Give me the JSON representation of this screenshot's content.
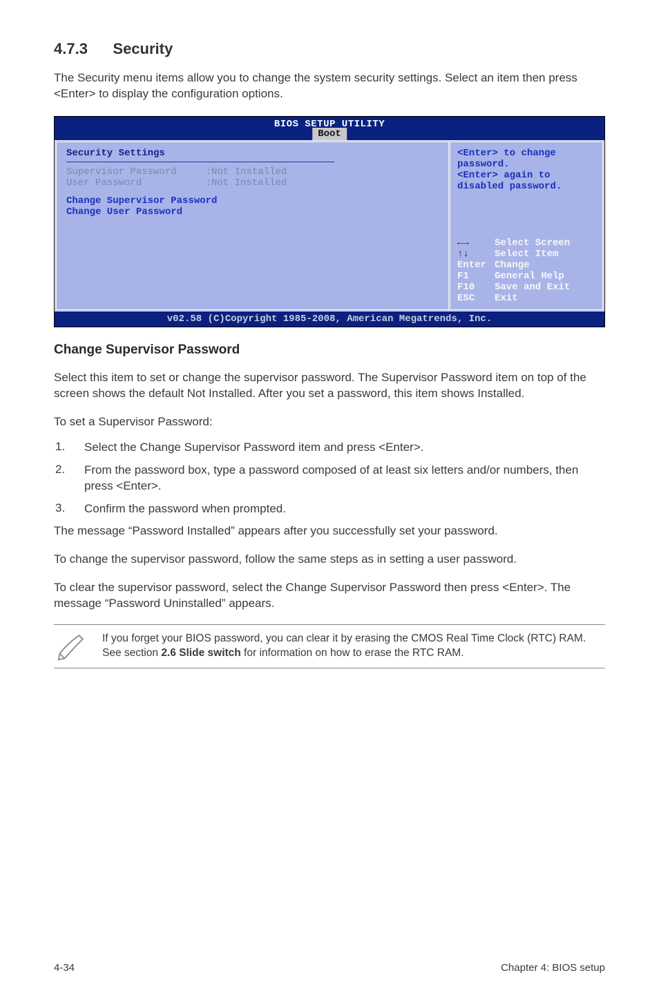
{
  "section": {
    "number": "4.7.3",
    "title": "Security"
  },
  "intro": "The Security menu items allow you to change the system security settings. Select an item then press <Enter> to display the configuration options.",
  "bios": {
    "headerTitle": "BIOS SETUP UTILITY",
    "tab": "Boot",
    "left": {
      "heading": "Security Settings",
      "row1_label": "Supervisor Password",
      "row1_value": ":Not Installed",
      "row2_label": "User Password",
      "row2_value": ":Not Installed",
      "chg1": "Change Supervisor Password",
      "chg2": "Change User Password"
    },
    "right": {
      "help1": "<Enter> to change password.",
      "help2": "<Enter> again to disabled password.",
      "nav": {
        "selectScreen": "Select Screen",
        "selectItem": "Select Item",
        "enterLabel": "Enter",
        "enterText": "Change",
        "f1Label": "F1",
        "f1Text": "General Help",
        "f10Label": "F10",
        "f10Text": "Save and Exit",
        "escLabel": "ESC",
        "escText": "Exit"
      }
    },
    "footer": "v02.58 (C)Copyright 1985-2008, American Megatrends, Inc."
  },
  "subHeading": "Change Supervisor Password",
  "p1": "Select this item to set or change the supervisor password. The Supervisor Password item on top of the screen shows the default Not Installed. After you set a password, this item shows Installed.",
  "p2": "To set a Supervisor Password:",
  "steps": {
    "s1": "Select the Change Supervisor Password item and press <Enter>.",
    "s2": "From the password box, type a password composed of at least six letters and/or numbers, then press <Enter>.",
    "s3": "Confirm the password when prompted."
  },
  "p3": "The message “Password Installed” appears after you successfully set your password.",
  "p4": "To change the supervisor password, follow the same steps as in setting a user password.",
  "p5": "To clear the supervisor password, select the Change Supervisor Password then press <Enter>. The message “Password Uninstalled” appears.",
  "note": {
    "pre": "If you forget your BIOS password, you can clear it by erasing the CMOS Real Time Clock (RTC) RAM. See section ",
    "bold": "2.6 Slide switch",
    "post": " for information on how to erase the RTC RAM."
  },
  "footer": {
    "left": "4-34",
    "right": "Chapter 4: BIOS setup"
  }
}
